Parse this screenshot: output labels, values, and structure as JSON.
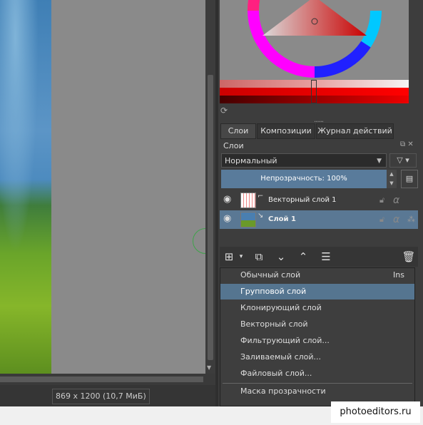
{
  "status": {
    "image_size": "869 x 1200 (10,7 МиБ)"
  },
  "tabs": [
    {
      "label": "Слои"
    },
    {
      "label": "Композиции"
    },
    {
      "label": "Журнал действий"
    }
  ],
  "layers_docker": {
    "title": "Слои",
    "blend_mode": "Нормальный",
    "opacity_label": "Непрозрачность:",
    "opacity_value": "100%"
  },
  "layers": [
    {
      "name": "Векторный слой 1",
      "selected": false
    },
    {
      "name": "Слой 1",
      "selected": true
    }
  ],
  "menu": {
    "items": [
      {
        "label": "Обычный слой",
        "shortcut": "Ins"
      },
      {
        "label": "Групповой слой",
        "highlighted": true
      },
      {
        "label": "Клонирующий слой"
      },
      {
        "label": "Векторный слой"
      },
      {
        "label": "Фильтрующий слой..."
      },
      {
        "label": "Заливаемый слой..."
      },
      {
        "label": "Файловый слой..."
      },
      {
        "label": "Маска прозрачности"
      }
    ]
  },
  "watermark": "photoeditors.ru",
  "icons": [
    "eye-icon",
    "add-layer-icon",
    "duplicate-icon",
    "move-down-icon",
    "move-up-icon",
    "properties-icon",
    "delete-icon",
    "filter-icon",
    "lock-icon",
    "alpha-icon",
    "refresh-icon"
  ],
  "colors": {
    "selection": "#557590",
    "opacity_bar": "#597b9b",
    "panel": "#3d3d3d"
  }
}
